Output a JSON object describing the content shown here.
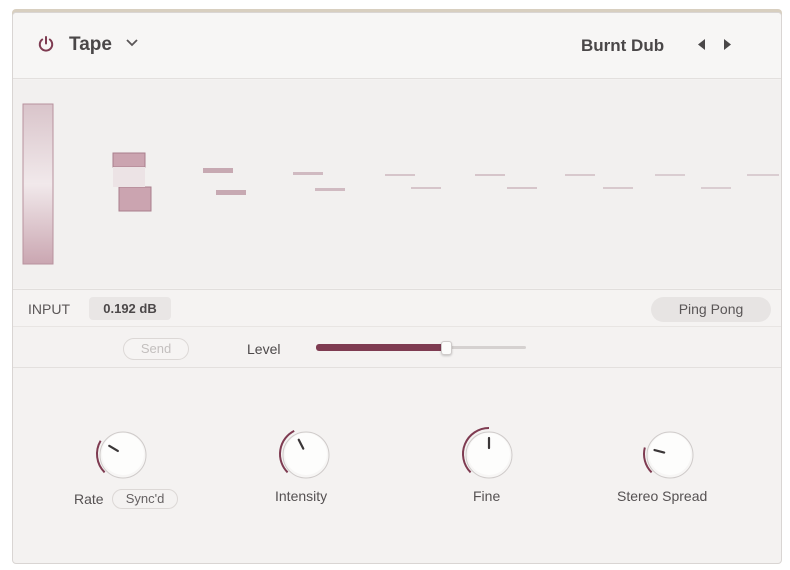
{
  "header": {
    "device_name": "Tape",
    "preset_name": "Burnt Dub"
  },
  "input": {
    "label": "INPUT",
    "value": "0.192 dB",
    "mode_button": "Ping Pong"
  },
  "send_row": {
    "send_label": "Send",
    "level_label": "Level",
    "level_fraction": 0.62
  },
  "knobs": [
    {
      "label": "Rate",
      "value_fraction": 0.28,
      "sub_label": "Sync'd"
    },
    {
      "label": "Intensity",
      "value_fraction": 0.4
    },
    {
      "label": "Fine",
      "value_fraction": 0.5
    },
    {
      "label": "Stereo Spread",
      "value_fraction": 0.22
    }
  ],
  "colors": {
    "accent": "#7e3b51",
    "accent_light": "#c9a3ae",
    "panel": "#f4f2f1"
  },
  "icons": {
    "power": "power-icon",
    "dropdown": "chevron-down-icon",
    "prev": "arrow-left-icon",
    "next": "arrow-right-icon"
  }
}
